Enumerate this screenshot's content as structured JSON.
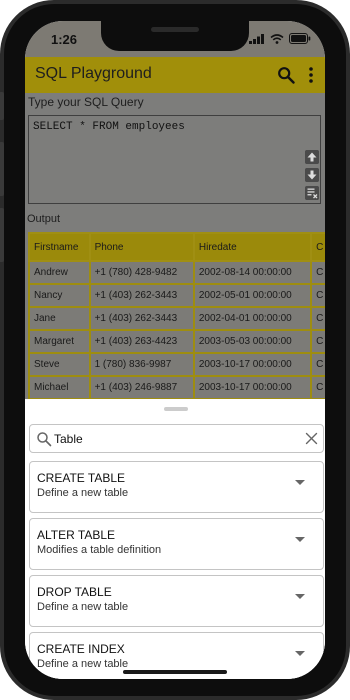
{
  "status_bar": {
    "time": "1:26"
  },
  "app_bar": {
    "title": "SQL Playground",
    "search_icon": "search-icon",
    "more_icon": "more-vertical-icon"
  },
  "editor": {
    "label": "Type your SQL Query",
    "query": "SELECT * FROM employees",
    "tools": [
      "arrow-up-icon",
      "arrow-down-icon",
      "clear-text-icon"
    ]
  },
  "output": {
    "label": "Output",
    "columns": [
      "Firstname",
      "Phone",
      "Hiredate",
      "C"
    ],
    "rows": [
      [
        "Andrew",
        "+1 (780) 428-9482",
        "2002-08-14 00:00:00",
        "C"
      ],
      [
        "Nancy",
        "+1 (403) 262-3443",
        "2002-05-01 00:00:00",
        "C"
      ],
      [
        "Jane",
        "+1 (403) 262-3443",
        "2002-04-01 00:00:00",
        "C"
      ],
      [
        "Margaret",
        "+1 (403) 263-4423",
        "2003-05-03 00:00:00",
        "C"
      ],
      [
        "Steve",
        "1 (780) 836-9987",
        "2003-10-17 00:00:00",
        "C"
      ],
      [
        "Michael",
        "+1 (403) 246-9887",
        "2003-10-17 00:00:00",
        "C"
      ]
    ]
  },
  "sheet": {
    "search": {
      "value": "Table",
      "placeholder": "Search"
    },
    "items": [
      {
        "title": "CREATE TABLE",
        "description": "Define a new table"
      },
      {
        "title": "ALTER TABLE",
        "description": "Modifies a table definition"
      },
      {
        "title": "DROP TABLE",
        "description": "Define a new table"
      },
      {
        "title": "CREATE INDEX",
        "description": "Define a new table"
      }
    ]
  },
  "colors": {
    "accent": "#a18f0a",
    "scrim": "#7d7d7b",
    "card_border": "#c4c4c4"
  }
}
